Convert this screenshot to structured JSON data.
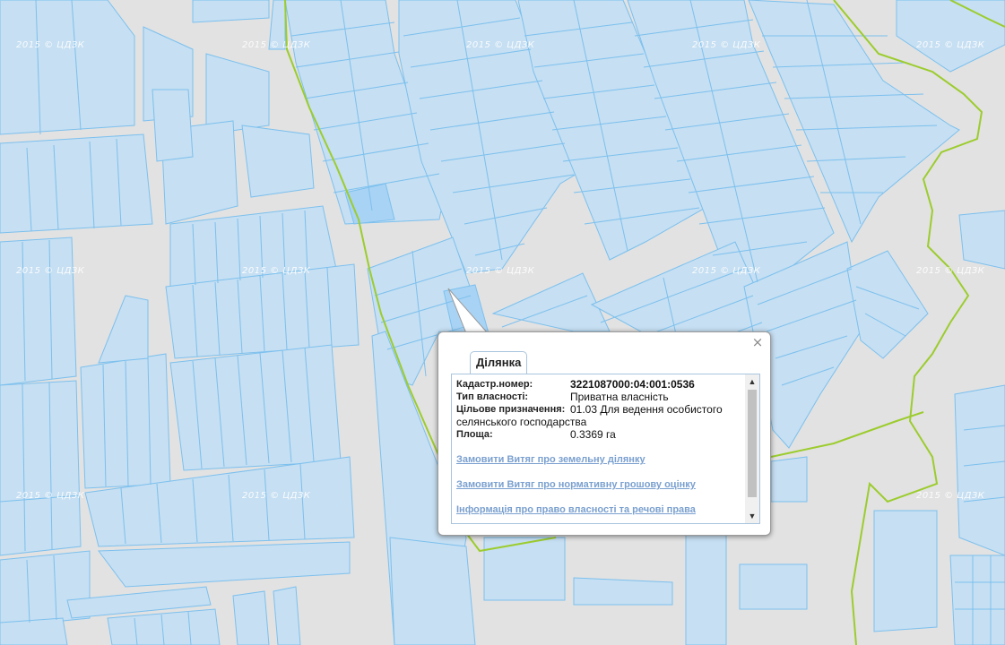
{
  "map": {
    "colors": {
      "background": "#e2e2e2",
      "parcel_fill": "#c6dff2",
      "parcel_stroke": "#7cc0ee",
      "parcel_selected": "#a9d3f4",
      "boundary": "#9ccc2e"
    },
    "watermark": "2015 © ЦДЗК"
  },
  "popup": {
    "close_icon": "close-icon",
    "tab_label": "Ділянка",
    "fields": {
      "cadastral_label": "Кадастр.номер:",
      "cadastral_value": "3221087000:04:001:0536",
      "ownership_label": "Тип власності:",
      "ownership_value": "Приватна власність",
      "purpose_label": "Цільове призначення:",
      "purpose_value": "01.03 Для ведення особистого",
      "purpose_value_cont": "селянського господарства",
      "area_label": "Площа:",
      "area_value": "0.3369 га"
    },
    "links": {
      "extract_land": "Замовити Витяг про земельну ділянку",
      "extract_valuation": "Замовити Витяг про нормативну грошову оцінку",
      "ownership_info": "Інформація про право власності та речові права"
    }
  }
}
